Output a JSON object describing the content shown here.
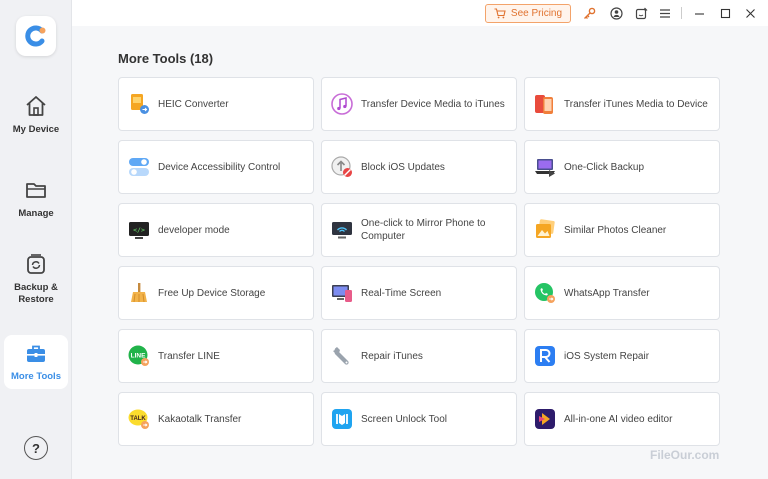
{
  "sidebar": {
    "items": [
      {
        "label": "My Device",
        "icon": "house-icon"
      },
      {
        "label": "Manage",
        "icon": "folder-icon"
      },
      {
        "label": "Backup & Restore",
        "icon": "backup-restore-icon"
      },
      {
        "label": "More Tools",
        "icon": "toolbox-icon",
        "active": true
      }
    ],
    "help_label": "?"
  },
  "titlebar": {
    "see_pricing": "See Pricing"
  },
  "main": {
    "title": "More Tools (18)",
    "tools": [
      {
        "label": "HEIC Converter",
        "icon": "heic-converter-icon"
      },
      {
        "label": "Transfer Device Media to iTunes",
        "icon": "itunes-note-icon"
      },
      {
        "label": "Transfer iTunes Media to Device",
        "icon": "phones-transfer-icon"
      },
      {
        "label": "Device Accessibility Control",
        "icon": "toggle-icon"
      },
      {
        "label": "Block iOS Updates",
        "icon": "block-update-icon"
      },
      {
        "label": "One-Click Backup",
        "icon": "laptop-backup-icon"
      },
      {
        "label": "developer mode",
        "icon": "terminal-icon"
      },
      {
        "label": "One-click to Mirror Phone to Computer",
        "icon": "mirror-screen-icon"
      },
      {
        "label": "Similar Photos Cleaner",
        "icon": "photos-icon"
      },
      {
        "label": "Free Up Device Storage",
        "icon": "broom-icon"
      },
      {
        "label": "Real-Time Screen",
        "icon": "realtime-screen-icon"
      },
      {
        "label": "WhatsApp Transfer",
        "icon": "whatsapp-icon"
      },
      {
        "label": "Transfer LINE",
        "icon": "line-icon"
      },
      {
        "label": "Repair iTunes",
        "icon": "wrench-icon"
      },
      {
        "label": "iOS System Repair",
        "icon": "system-repair-icon"
      },
      {
        "label": "Kakaotalk Transfer",
        "icon": "kakaotalk-icon"
      },
      {
        "label": "Screen Unlock Tool",
        "icon": "screen-unlock-icon"
      },
      {
        "label": "All-in-one AI video editor",
        "icon": "ai-video-editor-icon"
      }
    ]
  },
  "watermark": "FileOur.com",
  "colors": {
    "accent": "#3a8ee6",
    "pricing": "#e0722f"
  }
}
